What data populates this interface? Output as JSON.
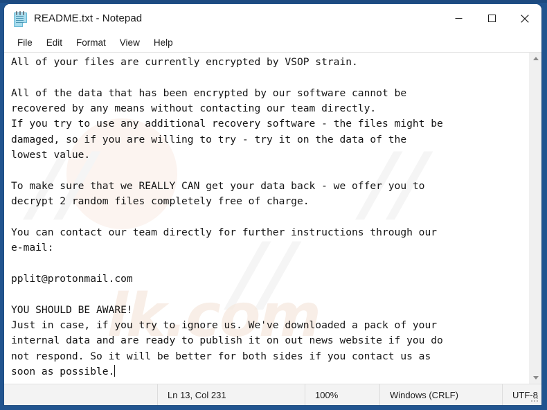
{
  "window": {
    "title": "README.txt - Notepad",
    "icon": "notepad-icon",
    "controls": {
      "minimize": "—",
      "maximize": "□",
      "close": "✕"
    }
  },
  "menubar": {
    "items": [
      {
        "label": "File"
      },
      {
        "label": "Edit"
      },
      {
        "label": "Format"
      },
      {
        "label": "View"
      },
      {
        "label": "Help"
      }
    ]
  },
  "editor": {
    "content": "All of your files are currently encrypted by VSOP strain.\n\nAll of the data that has been encrypted by our software cannot be\nrecovered by any means without contacting our team directly.\nIf you try to use any additional recovery software - the files might be\ndamaged, so if you are willing to try - try it on the data of the\nlowest value.\n\nTo make sure that we REALLY CAN get your data back - we offer you to\ndecrypt 2 random files completely free of charge.\n\nYou can contact our team directly for further instructions through our\ne-mail:\n\npplit@protonmail.com\n\nYOU SHOULD BE AWARE!\nJust in case, if you try to ignore us. We've downloaded a pack of your\ninternal data and are ready to publish it on out news website if you do\nnot respond. So it will be better for both sides if you contact us as\nsoon as possible.",
    "email": "pplit@protonmail.com",
    "ransomware_strain": "VSOP"
  },
  "watermark": {
    "text": "lk.com",
    "slash": "//"
  },
  "scrollbar": {
    "up_arrow": "scroll-up-arrow",
    "down_arrow": "scroll-down-arrow"
  },
  "statusbar": {
    "cursor_position": "Ln 13, Col 231",
    "zoom": "100%",
    "line_ending": "Windows (CRLF)",
    "encoding": "UTF-8"
  },
  "colors": {
    "desktop": "#21548f",
    "window_bg": "#ffffff",
    "statusbar_bg": "#f3f3f3",
    "text": "#151515"
  }
}
